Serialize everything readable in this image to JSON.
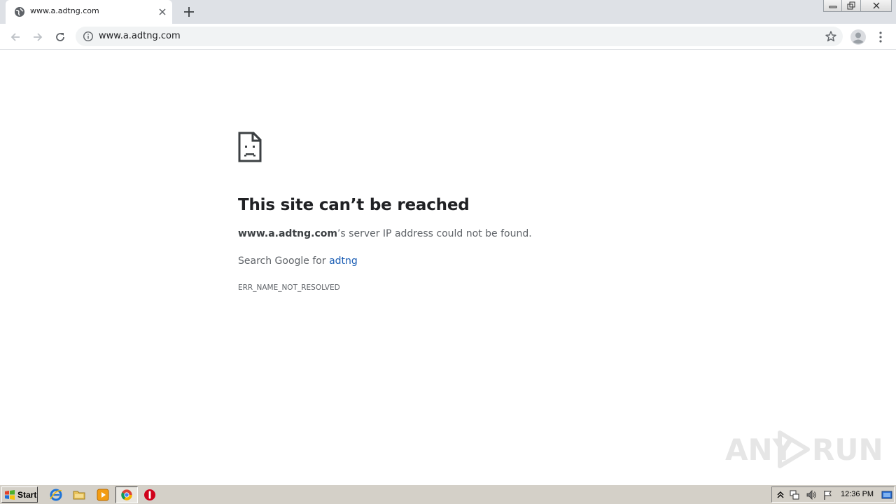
{
  "browser": {
    "tab": {
      "title": "www.a.adtng.com",
      "favicon": "globe-icon",
      "close": "close-icon"
    },
    "new_tab": "plus-icon",
    "window_controls": [
      "minimize-icon",
      "restore-icon",
      "close-icon"
    ],
    "toolbar": {
      "back": "back-arrow-icon",
      "forward": "forward-arrow-icon",
      "reload": "reload-icon",
      "url": "www.a.adtng.com",
      "site_info": "info-icon",
      "bookmark": "star-icon",
      "profile": "profile-icon",
      "menu": "kebab-menu-icon"
    }
  },
  "error_page": {
    "icon": "sad-page-icon",
    "title": "This site can’t be reached",
    "domain": "www.a.adtng.com",
    "desc_suffix": "’s server IP address could not be found.",
    "search_prefix": "Search Google for ",
    "search_term": "adtng",
    "error_code": "ERR_NAME_NOT_RESOLVED"
  },
  "watermark": {
    "text_left": "ANY",
    "text_right": "RUN"
  },
  "taskbar": {
    "start_label": "Start",
    "quick_launch": [
      "ie-icon",
      "folder-icon",
      "media-player-icon",
      "chrome-icon",
      "stop-icon"
    ],
    "tray": [
      "arrow-up-icon",
      "network-icon",
      "volume-icon",
      "flag-icon",
      "show-desktop-icon"
    ],
    "clock": "12:36 PM"
  },
  "colors": {
    "tabstrip": "#dee1e6",
    "omnibox": "#f1f3f4",
    "link": "#1a5db4",
    "taskbar": "#d4d0c8"
  }
}
